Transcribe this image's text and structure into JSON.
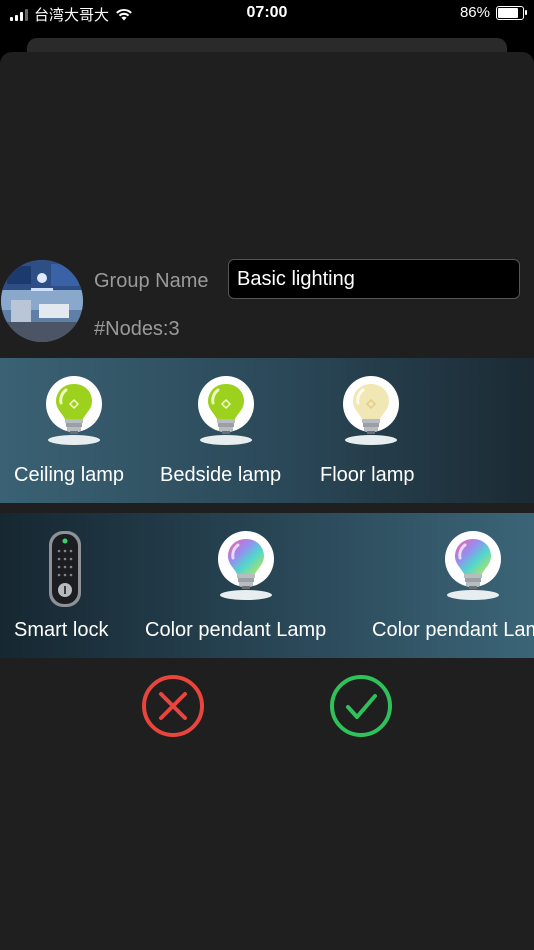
{
  "status_bar": {
    "carrier": "台湾大哥大",
    "time": "07:00",
    "battery_percent": "86%",
    "battery_level": 0.86
  },
  "group": {
    "name_label": "Group Name",
    "name_value": "Basic lighting",
    "nodes_text": "#Nodes:3"
  },
  "selected_devices": [
    {
      "label": "Ceiling lamp",
      "icon": "green-bulb-icon"
    },
    {
      "label": "Bedside lamp",
      "icon": "green-bulb-icon"
    },
    {
      "label": "Floor lamp",
      "icon": "warm-bulb-icon"
    }
  ],
  "available_devices": [
    {
      "label": "Smart lock",
      "icon": "smart-lock-icon"
    },
    {
      "label": "Color pendant Lamp",
      "icon": "color-bulb-icon"
    },
    {
      "label": "Color pendant Lamp",
      "icon": "color-bulb-icon"
    }
  ],
  "actions": {
    "cancel_color": "#e8453c",
    "confirm_color": "#2fc25b",
    "cancel_icon": "x-circle-icon",
    "confirm_icon": "check-circle-icon"
  }
}
